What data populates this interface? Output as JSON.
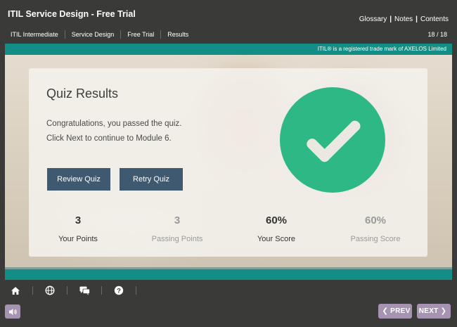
{
  "header": {
    "title": "ITIL Service Design - Free Trial",
    "links": [
      "Glossary",
      "Notes",
      "Contents"
    ],
    "breadcrumb": [
      "ITIL Intermediate",
      "Service Design",
      "Free Trial",
      "Results"
    ],
    "page_count": "18 / 18",
    "trademark": "ITIL® is a registered trade mark of AXELOS Limited"
  },
  "quiz": {
    "title": "Quiz Results",
    "message_line1": "Congratulations, you passed the quiz.",
    "message_line2": "Click Next to continue to Module 6.",
    "review_button": "Review Quiz",
    "retry_button": "Retry Quiz",
    "status_icon": "check-icon",
    "stats": [
      {
        "value": "3",
        "label": "Your Points"
      },
      {
        "value": "3",
        "label": "Passing Points"
      },
      {
        "value": "60%",
        "label": "Your Score"
      },
      {
        "value": "60%",
        "label": "Passing Score"
      }
    ]
  },
  "footer": {
    "icons": [
      "home-icon",
      "globe-icon",
      "chat-icon",
      "help-icon"
    ],
    "sound_icon": "speaker-icon",
    "prev_label": "PREV",
    "next_label": "NEXT"
  },
  "colors": {
    "background": "#3a3b39",
    "teal": "#128e86",
    "success_green": "#2db886",
    "button_blue": "#3f5a70",
    "nav_purple": "#a693b2"
  }
}
